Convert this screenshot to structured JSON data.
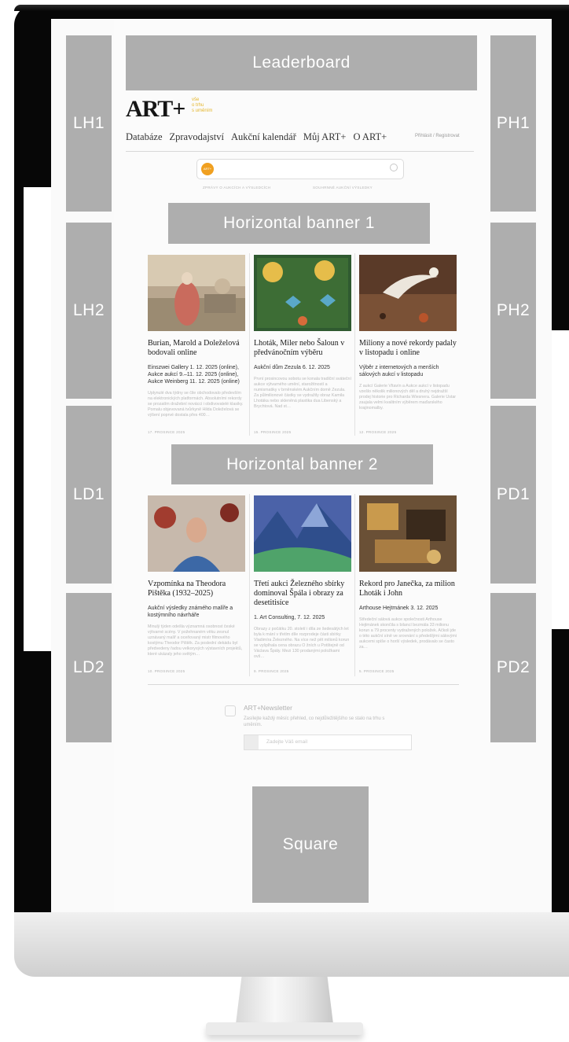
{
  "ad_slots": {
    "leaderboard": "Leaderboard",
    "lh1": "LH1",
    "lh2": "LH2",
    "ld1": "LD1",
    "ld2": "LD2",
    "ph1": "PH1",
    "ph2": "PH2",
    "pd1": "PD1",
    "pd2": "PD2",
    "horizontal_banner_1": "Horizontal banner 1",
    "horizontal_banner_2": "Horizontal banner 2",
    "square": "Square"
  },
  "site": {
    "logo": "ART+",
    "tagline_1": "vše",
    "tagline_2": "o trhu",
    "tagline_3": "s uměním",
    "login": "Přihlásit / Registrovat"
  },
  "nav": [
    "Databáze",
    "Zpravodajství",
    "Aukční kalendář",
    "Můj ART+",
    "O ART+"
  ],
  "search": {
    "placeholder": "",
    "badge": "ART+",
    "quick_link_1": "ZPRÁVY O AUKCÍCH A VÝSLEDCÍCH",
    "quick_link_2": "SOUHRNNÉ AUKČNÍ VÝSLEDKY"
  },
  "articles_row_1": [
    {
      "title": "Burian, Marold a Doleželová bodovali online",
      "sub": "Einszwei Gallery 1. 12. 2025 (online), Aukce aukcí 9.–11. 12. 2025 (online), Aukce Weinberg 11. 12. 2025 (online)",
      "desc": "Uplynulé dva týdny se čile obchodovalo především na elektronických platformách. Absolutními rekordy se prozatím dražební novácci i obdivovatelé klasiky. Pomalu objevovaná tvůrkyně Hilda Doleželová se výšení poprvé dostala přes 400…",
      "date": "17. PROSINCE 2025"
    },
    {
      "title": "Lhoták, Miler nebo Šaloun v předvánočním výběru",
      "sub": "Aukční dům Zezula 6. 12. 2025",
      "desc": "První prosincovou sobotu se konala tradiční sváteční aukce výtvarného umění, starožitností a numismatiky v brněnském Aukčním domě Zezula. Za půlmilionové částky se vydražily obraz Kamila Lhotáka nebo skleněná plastika dua Libenský a Brychtová. Nad st…",
      "date": "15. PROSINCE 2025"
    },
    {
      "title": "Miliony a nové rekordy padaly v listopadu i online",
      "sub": "Výběr z internetových a menších sálových aukcí v listopadu",
      "desc": "Z aukcí Galerie Vltavín a Aukce aukcí v listopadu vzešlo několik milionových děl a druhý nejdražší prodej historie pro Richarda Wiesnera. Galerie Ustar zaujala velmi kvalitním výběrem maďarského krajinomalby.",
      "date": "12. PROSINCE 2025"
    }
  ],
  "articles_row_2": [
    {
      "title": "Vzpomínka na Theodora Pištěka (1932–2025)",
      "sub": "Aukční výsledky známého malíře a kostýmního návrháře",
      "desc": "Minulý týden odešla významná osobnost české výtvarné scény. V požehnaném věku zesnul uznávaný malíř a oceňovaný mistr filmového kostýmu Theodor Pištěk. Za poslední dekádu byl předvedeny řadou velkorysých výstavních projektů, které ukázaly jeho světým…",
      "date": "10. PROSINCE 2025"
    },
    {
      "title": "Třetí aukci Železného sbírky dominoval Špála i obrazy za desetitisíce",
      "sub": "1. Art Consulting, 7. 12. 2025",
      "desc": "Obrazy z počátku 20. století i díla ze šedesátých let byla k mání v třetím díle rozprodeje části sbírky Vladimíra Železného. Na více než pět milionů korun se vyšplhala cena obrazu O žních u Potštejně od Václava Špály. Mezi 130 prodanými položkami ovš…",
      "date": "9. PROSINCE 2025"
    },
    {
      "title": "Rekord pro Janečka, za milion Lhoták i John",
      "sub": "Arthouse Hejtmánek 3. 12. 2025",
      "desc": "Středeční sálová aukce společnosti Arthouse Hejtmánek skončila s bilancí bezmála 33 milionu korun a 79 procenty vydražených položek. Ačkoli jde o této aukční síně ve srovnání s předešlými sálovými aukcemi spíše o horší výsledek, prodávalo se často za…",
      "date": "5. PROSINCE 2025"
    }
  ],
  "newsletter": {
    "title": "ART+Newsletter",
    "text": "Zasílejte každý měsíc přehled, co nejdůležitějšího se stalo na trhu s uměním.",
    "placeholder": "Zadejte Váš email"
  }
}
